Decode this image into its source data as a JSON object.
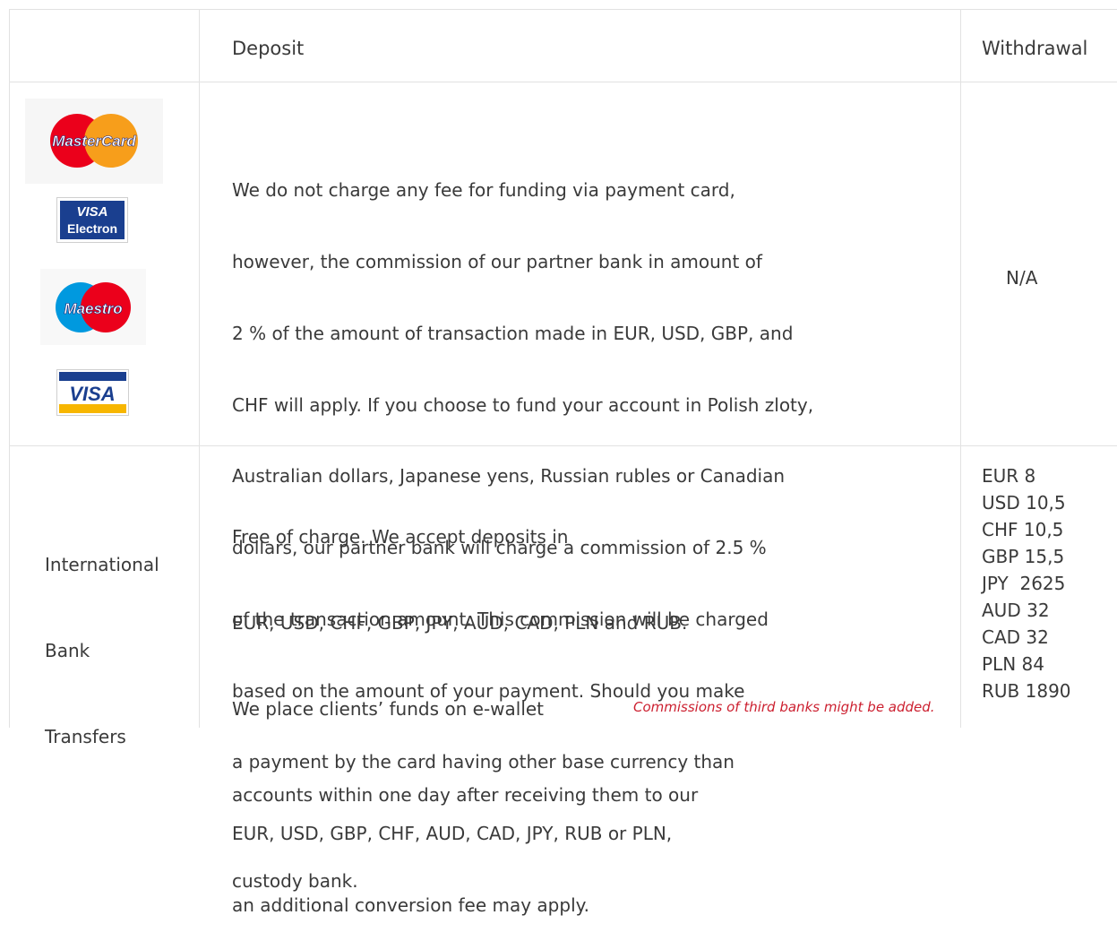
{
  "table": {
    "header": {
      "col1": "",
      "deposit": "Deposit",
      "withdrawal": "Withdrawal"
    },
    "row_cards": {
      "logos": [
        {
          "name": "mastercard",
          "text": "MasterCard"
        },
        {
          "name": "visa-electron",
          "text_top": "VISA",
          "text_bottom": "Electron"
        },
        {
          "name": "maestro",
          "text": "Maestro"
        },
        {
          "name": "visa",
          "text": "VISA"
        }
      ],
      "deposit_lines": [
        "We do not charge any fee for funding via payment card,",
        "however, the commission of our partner bank in amount of",
        "2 % of the amount of transaction made in EUR, USD, GBP, and",
        "CHF will apply. If you choose to fund your account in Polish zloty,",
        "Australian dollars, Japanese yens, Russian rubles or Canadian",
        "dollars, our partner bank will charge a commission of 2.5 %",
        "of the transaction amount. This commission will be charged",
        "based on the amount of your payment. Should you make",
        "a payment by the card having other base currency than",
        "EUR, USD, GBP, CHF, AUD, CAD, JPY, RUB or PLN,",
        "an additional conversion fee may apply."
      ],
      "withdrawal": "N/A"
    },
    "row_bank": {
      "label_lines": [
        "International",
        "Bank",
        "Transfers"
      ],
      "deposit_lines": [
        "Free of charge. We accept deposits in",
        "EUR, USD, CHF, GBP, JPY, AUD, CAD, PLN and RUB.",
        "We place clients’ funds on e-wallet",
        "accounts within one day after receiving them to our",
        "custody bank."
      ],
      "note": "Commissions of third banks might be added.",
      "withdrawal_fees": [
        {
          "currency": "EUR",
          "amount": "8"
        },
        {
          "currency": "USD",
          "amount": "10,5"
        },
        {
          "currency": "CHF",
          "amount": "10,5"
        },
        {
          "currency": "GBP",
          "amount": "15,5"
        },
        {
          "currency": "JPY",
          "amount": "2625"
        },
        {
          "currency": "AUD",
          "amount": "32"
        },
        {
          "currency": "CAD",
          "amount": "32"
        },
        {
          "currency": "PLN",
          "amount": "84"
        },
        {
          "currency": "RUB",
          "amount": "1890"
        }
      ]
    }
  },
  "colors": {
    "grid": "#e2e2e2",
    "text": "#3a3a3a",
    "note": "#cc1f2f",
    "mastercard_red": "#eb001b",
    "mastercard_orange": "#f79e1b",
    "maestro_blue": "#0099df",
    "visa_blue": "#1a1f71",
    "visa_gold": "#f7b600"
  }
}
